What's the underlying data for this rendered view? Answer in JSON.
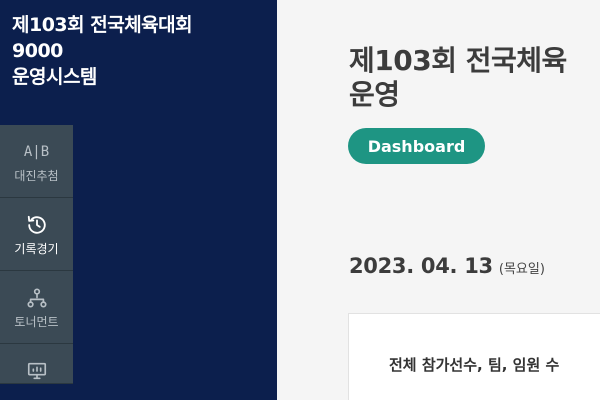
{
  "app": {
    "title_lines": [
      "제103회 전국체육대회",
      "9000",
      "운영시스템"
    ]
  },
  "sidebar": {
    "items": [
      {
        "label": "대진추첨",
        "icon": "ab-icon",
        "icon_text": "A|B"
      },
      {
        "label": "기록경기",
        "icon": "history-icon"
      },
      {
        "label": "토너먼트",
        "icon": "tournament-icon"
      },
      {
        "label": "",
        "icon": "monitor-icon"
      }
    ]
  },
  "main": {
    "title_lines": [
      "제103회 전국체육",
      "운영"
    ],
    "badge": "Dashboard",
    "date": "2023. 04. 13",
    "weekday": "(목요일)",
    "card_title": "전체 참가선수, 팀, 임원 수"
  },
  "colors": {
    "sidebar_bg": "#0c1f4d",
    "menu_bg": "#3b4a55",
    "accent": "#1e9583",
    "main_bg": "#f5f5f5"
  }
}
